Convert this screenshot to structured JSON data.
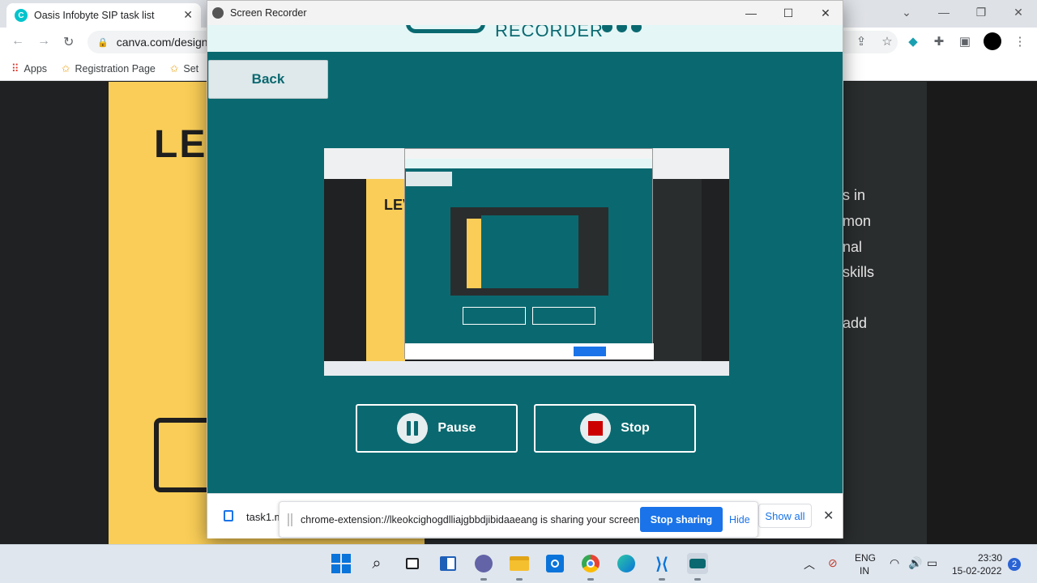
{
  "browser": {
    "tab_title": "Oasis Infobyte SIP task list",
    "url": "canva.com/design/",
    "bookmarks": [
      "Apps",
      "Registration Page",
      "Set"
    ]
  },
  "canva": {
    "heading_partial": "LEV",
    "side_text": [
      "s in",
      "mon",
      "nal",
      "skills",
      "add"
    ]
  },
  "recorder": {
    "window_title": "Screen Recorder",
    "header_word": "RECORDER",
    "back_label": "Back",
    "pause_label": "Pause",
    "stop_label": "Stop"
  },
  "downloads": {
    "file_name": "task1.m",
    "show_all_label": "Show all"
  },
  "sharing": {
    "message": "chrome-extension://lkeokcighogdlliajgbbdjibidaaeang is sharing your screen.",
    "stop_label": "Stop sharing",
    "hide_label": "Hide"
  },
  "taskbar": {
    "lang": "ENG",
    "region": "IN",
    "time": "23:30",
    "date": "15-02-2022",
    "notification_count": "2"
  },
  "colors": {
    "recorder_teal": "#0a6970",
    "stop_red": "#cc0000",
    "chrome_blue": "#1a73e8",
    "canva_yellow": "#f9cd57"
  }
}
